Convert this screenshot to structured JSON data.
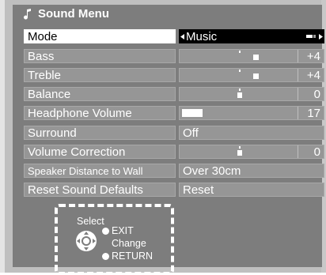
{
  "menu": {
    "title": "Sound Menu",
    "title_icon": "music-note-icon",
    "rows": [
      {
        "label": "Mode",
        "value": "Music",
        "selected": true
      },
      {
        "label": "Bass",
        "value": "+4",
        "level": 0.6
      },
      {
        "label": "Treble",
        "value": "+4",
        "level": 0.6
      },
      {
        "label": "Balance",
        "value": "0",
        "level": 0.5
      },
      {
        "label": "Headphone Volume",
        "value": "17",
        "level": 0.17
      },
      {
        "label": "Surround",
        "value": "Off"
      },
      {
        "label": "Volume Correction",
        "value": "0",
        "level": 0.5
      },
      {
        "label": "Speaker Distance to Wall",
        "value": "Over 30cm"
      },
      {
        "label": "Reset Sound Defaults",
        "value": "Reset"
      }
    ]
  },
  "legend": {
    "select": "Select",
    "exit": "EXIT",
    "change": "Change",
    "return": "RETURN",
    "dpad_icon": "dpad-icon"
  },
  "colors": {
    "panel_bg": "#7d7d7d",
    "row_bg": "#969696",
    "selected_label_bg": "#ffffff",
    "selected_value_bg": "#000000",
    "text": "#ffffff"
  }
}
